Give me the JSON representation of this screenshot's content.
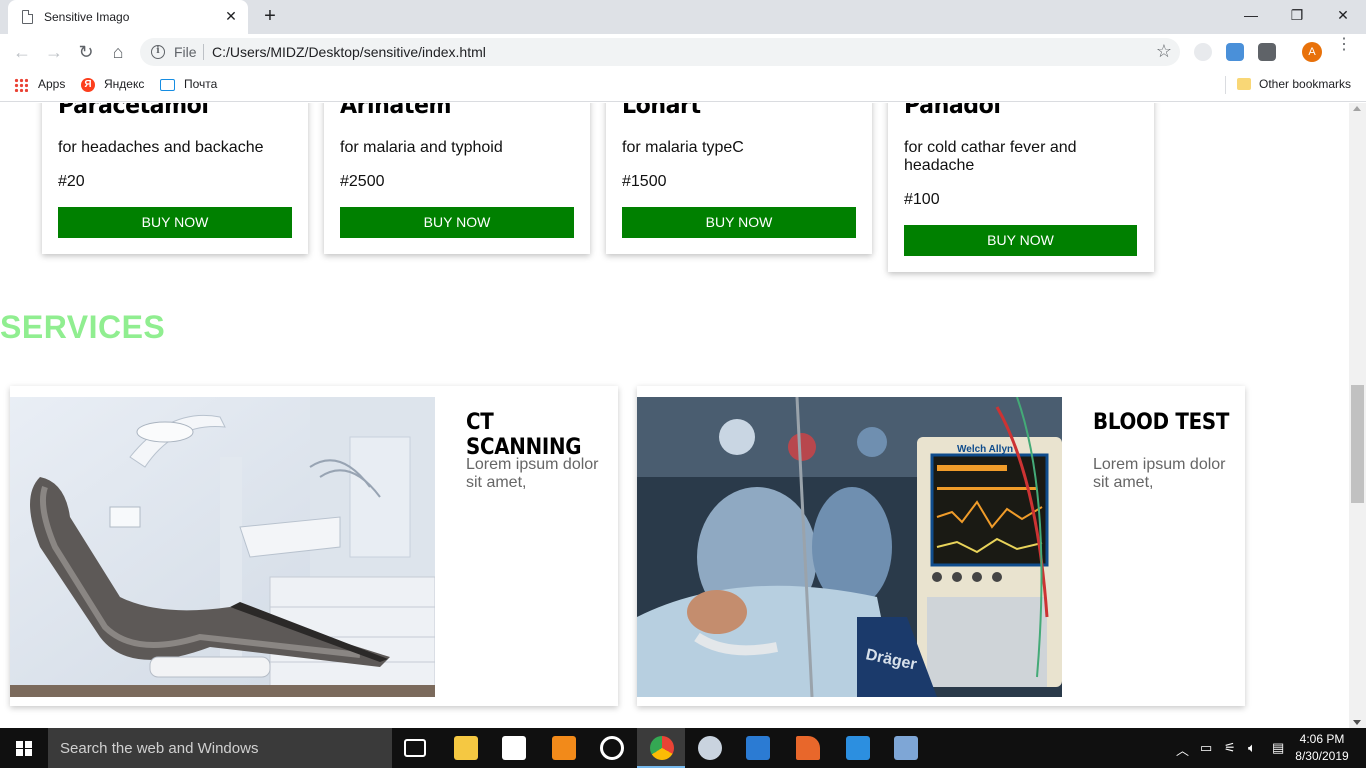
{
  "browser": {
    "tab_title": "Sensitive Imago",
    "tab_close": "✕",
    "new_tab": "+",
    "window_controls": {
      "minimize": "—",
      "restore": "❐",
      "close": "✕"
    },
    "nav": {
      "back": "←",
      "forward": "→",
      "reload": "↻",
      "home": "⌂"
    },
    "address": {
      "scheme_label": "File",
      "url": "C:/Users/MIDZ/Desktop/sensitive/index.html"
    },
    "bookmark_star": "☆",
    "profile_initial": "A",
    "menu": "⋮"
  },
  "bookmarks": {
    "items": [
      {
        "label": "Apps",
        "icon": "apps-grid-icon"
      },
      {
        "label": "Яндекс",
        "icon": "yandex-icon"
      },
      {
        "label": "Почта",
        "icon": "mail-icon"
      }
    ],
    "yandex_letter": "Я",
    "other": "Other bookmarks"
  },
  "products": [
    {
      "name": "Paracetamol",
      "description": "for headaches and backache",
      "price": "#20",
      "button": "BUY NOW"
    },
    {
      "name": "Arinatem",
      "description": "for malaria and typhoid",
      "price": "#2500",
      "button": "BUY NOW"
    },
    {
      "name": "Lonart",
      "description": "for malaria typeC",
      "price": "#1500",
      "button": "BUY NOW"
    },
    {
      "name": "Panadol",
      "description": "for cold cathar fever and headache",
      "price": "#100",
      "button": "BUY NOW"
    }
  ],
  "services": {
    "heading": "SERVICES",
    "items": [
      {
        "title": "CT SCANNING",
        "text": "Lorem ipsum dolor sit amet,",
        "image": "dental-chair-photo"
      },
      {
        "title": "BLOOD TEST",
        "text": "Lorem ipsum dolor sit amet,",
        "image": "hospital-monitor-photo",
        "monitor_brand": "Welch Allyn",
        "device_brand": "Dräger"
      }
    ]
  },
  "taskbar": {
    "search_placeholder": "Search the web and Windows",
    "clock_time": "4:06 PM",
    "clock_date": "8/30/2019",
    "accent": "#76b9ed"
  },
  "colors": {
    "buy_button": "#008000",
    "services_heading": "#90ee90",
    "profile_avatar": "#e8710a"
  }
}
